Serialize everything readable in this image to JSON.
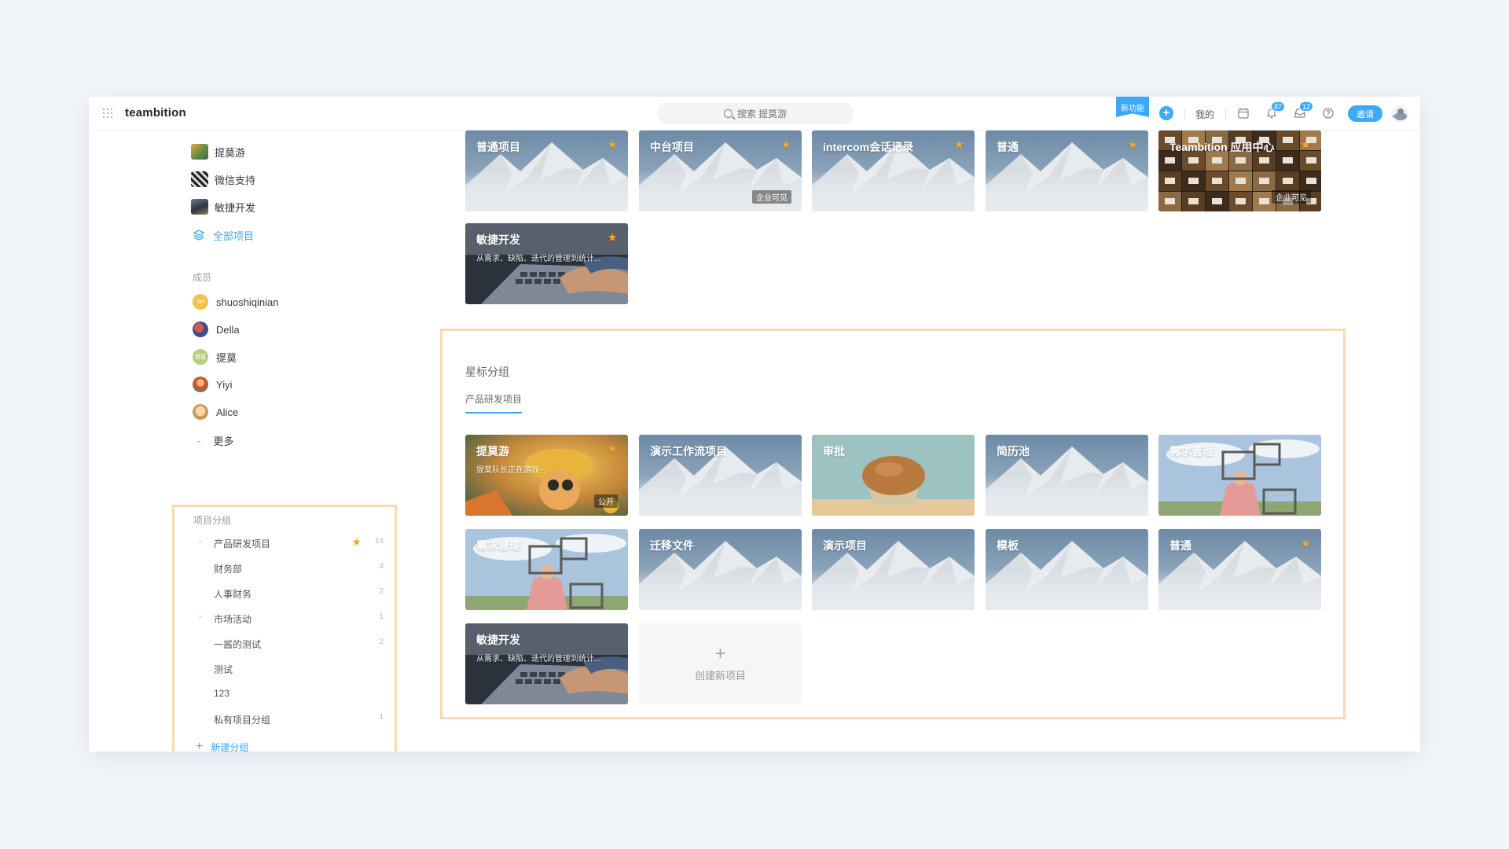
{
  "app": {
    "logo": "teambition"
  },
  "topbar": {
    "search_placeholder": "搜索 提莫游",
    "new_feature": "新功能",
    "mine": "我的",
    "notify_badge": "87",
    "inbox_badge": "12",
    "invite": "邀请"
  },
  "sidebar": {
    "projects": [
      {
        "label": "提莫游"
      },
      {
        "label": "微信支持"
      },
      {
        "label": "敏捷开发"
      }
    ],
    "all_projects": "全部项目",
    "members_label": "成员",
    "members": [
      {
        "name": "shuoshiqinian",
        "initials": "SH"
      },
      {
        "name": "Della",
        "initials": ""
      },
      {
        "name": "提莫",
        "initials": "提莫"
      },
      {
        "name": "Yiyi",
        "initials": ""
      },
      {
        "name": "Alice",
        "initials": ""
      }
    ],
    "more": "更多",
    "groups_label": "项目分组",
    "groups": [
      {
        "name": "产品研发项目",
        "count": "14",
        "expandable": true,
        "starred": true
      },
      {
        "name": "财务部",
        "count": "4",
        "expandable": false,
        "starred": false
      },
      {
        "name": "人事财务",
        "count": "2",
        "expandable": false,
        "starred": false
      },
      {
        "name": "市场活动",
        "count": "1",
        "expandable": true,
        "starred": false
      },
      {
        "name": "一酱的测试",
        "count": "2",
        "expandable": false,
        "starred": false
      },
      {
        "name": "测试",
        "count": "",
        "expandable": false,
        "starred": false
      },
      {
        "name": "123",
        "count": "",
        "expandable": false,
        "starred": false
      },
      {
        "name": "私有项目分组",
        "count": "1",
        "expandable": false,
        "starred": false
      }
    ],
    "new_group": "新建分组"
  },
  "top_cards": [
    {
      "title": "普通项目",
      "desc": "",
      "vis": "",
      "star": true,
      "theme": "mountain"
    },
    {
      "title": "中台项目",
      "desc": "",
      "vis": "企业可见",
      "star": true,
      "theme": "mountain"
    },
    {
      "title": "intercom会话记录",
      "desc": "",
      "vis": "",
      "star": true,
      "theme": "mountain"
    },
    {
      "title": "普通",
      "desc": "",
      "vis": "",
      "star": true,
      "theme": "mountain"
    },
    {
      "title": "Teambition 应用中心",
      "desc": "",
      "vis": "企业可见",
      "star": true,
      "theme": "drawers"
    },
    {
      "title": "敏捷开发",
      "desc": "从需求、缺陷、迭代的管理到统计...",
      "vis": "",
      "star": true,
      "theme": "laptop"
    }
  ],
  "starred_section": {
    "title": "星标分组",
    "tab": "产品研发项目",
    "cards": [
      {
        "title": "提莫游",
        "desc": "提莫队长正在游戏~",
        "vis": "公开",
        "star": true,
        "theme": "game"
      },
      {
        "title": "演示工作流项目",
        "desc": "",
        "vis": "",
        "star": false,
        "theme": "mountain"
      },
      {
        "title": "审批",
        "desc": "",
        "vis": "",
        "star": false,
        "theme": "muffin"
      },
      {
        "title": "简历池",
        "desc": "",
        "vis": "",
        "star": false,
        "theme": "mountain"
      },
      {
        "title": "需求管理",
        "desc": "",
        "vis": "",
        "star": false,
        "theme": "frames"
      },
      {
        "title": "需求管理",
        "desc": "",
        "vis": "",
        "star": false,
        "theme": "frames"
      },
      {
        "title": "迁移文件",
        "desc": "",
        "vis": "",
        "star": false,
        "theme": "mountain"
      },
      {
        "title": "演示项目",
        "desc": "",
        "vis": "",
        "star": false,
        "theme": "mountain"
      },
      {
        "title": "模板",
        "desc": "",
        "vis": "",
        "star": false,
        "theme": "mountain"
      },
      {
        "title": "普通",
        "desc": "",
        "vis": "",
        "star": true,
        "theme": "mountain"
      },
      {
        "title": "敏捷开发",
        "desc": "从需求、缺陷、迭代的管理到统计...",
        "vis": "",
        "star": false,
        "theme": "laptop"
      }
    ],
    "create_label": "创建新项目"
  },
  "colors": {
    "accent": "#3da8f5",
    "highlight_border": "#f9d9b4",
    "star": "#f7a531"
  }
}
